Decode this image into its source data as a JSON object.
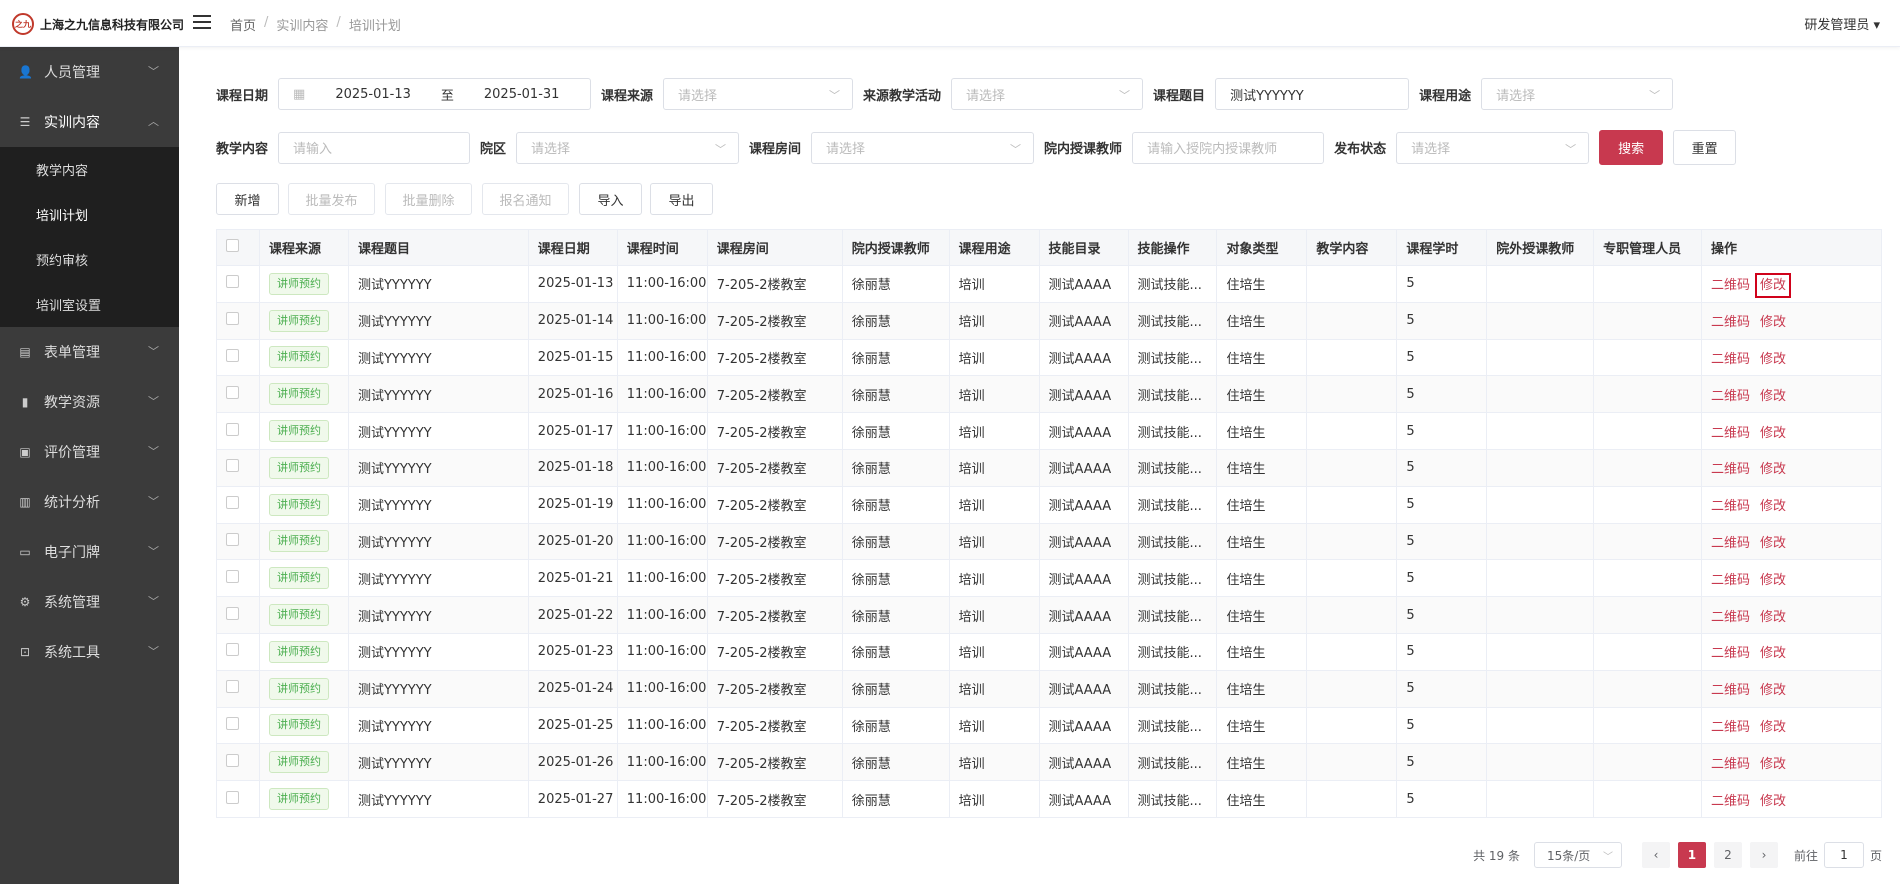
{
  "header": {
    "logo_mark": "之九",
    "logo_text": "上海之九信息科技有限公司",
    "breadcrumb": [
      "首页",
      "实训内容",
      "培训计划"
    ],
    "user": "研发管理员 ▾"
  },
  "sidebar": {
    "items": [
      {
        "label": "人员管理",
        "icon": "user-icon"
      },
      {
        "label": "实训内容",
        "icon": "book-icon",
        "expanded": true
      },
      {
        "label": "表单管理",
        "icon": "form-icon"
      },
      {
        "label": "教学资源",
        "icon": "resource-icon"
      },
      {
        "label": "评价管理",
        "icon": "evaluate-icon"
      },
      {
        "label": "统计分析",
        "icon": "chart-icon"
      },
      {
        "label": "电子门牌",
        "icon": "monitor-icon"
      },
      {
        "label": "系统管理",
        "icon": "gear-icon"
      },
      {
        "label": "系统工具",
        "icon": "toolbox-icon"
      }
    ],
    "sub_items": [
      "教学内容",
      "培训计划",
      "预约审核",
      "培训室设置"
    ],
    "active_sub": "培训计划"
  },
  "filters": {
    "course_date_label": "课程日期",
    "date_start": "2025-01-13",
    "date_sep": "至",
    "date_end": "2025-01-31",
    "course_source_label": "课程来源",
    "course_source_placeholder": "请选择",
    "source_activity_label": "来源教学活动",
    "source_activity_placeholder": "请选择",
    "course_title_label": "课程题目",
    "course_title_value": "测试YYYYYY",
    "course_use_label": "课程用途",
    "course_use_placeholder": "请选择",
    "teach_content_label": "教学内容",
    "teach_content_placeholder": "请输入",
    "campus_label": "院区",
    "campus_placeholder": "请选择",
    "room_label": "课程房间",
    "room_placeholder": "请选择",
    "inner_teacher_label": "院内授课教师",
    "inner_teacher_placeholder": "请输入授院内授课教师",
    "publish_label": "发布状态",
    "publish_placeholder": "请选择",
    "search": "搜索",
    "reset": "重置"
  },
  "toolbar": {
    "add": "新增",
    "batch_publish": "批量发布",
    "batch_delete": "批量删除",
    "signup_notice": "报名通知",
    "import": "导入",
    "export": "导出"
  },
  "table": {
    "columns": [
      "课程来源",
      "课程题目",
      "课程日期",
      "课程时间",
      "课程房间",
      "院内授课教师",
      "课程用途",
      "技能目录",
      "技能操作",
      "对象类型",
      "教学内容",
      "课程学时",
      "院外授课教师",
      "专职管理人员",
      "操作"
    ],
    "row_template": {
      "source": "讲师预约",
      "title": "测试YYYYYY",
      "time": "11:00-16:00",
      "room": "7-205-2楼教室",
      "teacher": "徐丽慧",
      "use": "培训",
      "skill_dir": "测试AAAA",
      "skill_op": "测试技能...",
      "target": "住培生",
      "content": "",
      "hours": "5",
      "outer_teacher": "",
      "manager": ""
    },
    "dates": [
      "2025-01-13",
      "2025-01-14",
      "2025-01-15",
      "2025-01-16",
      "2025-01-17",
      "2025-01-18",
      "2025-01-19",
      "2025-01-20",
      "2025-01-21",
      "2025-01-22",
      "2025-01-23",
      "2025-01-24",
      "2025-01-25",
      "2025-01-26",
      "2025-01-27"
    ],
    "op_qrcode": "二维码",
    "op_edit": "修改"
  },
  "pagination": {
    "total": "共 19 条",
    "page_size": "15条/页",
    "pages": [
      "1",
      "2"
    ],
    "current": "1",
    "goto_label": "前往",
    "goto_value": "1",
    "page_suffix": "页",
    "prev": "‹",
    "next": "›"
  },
  "colors": {
    "accent": "#c8394f",
    "sidebar_bg": "#3b3b3b",
    "submenu_bg": "#1f1f1f",
    "tag_green": "#4caf50"
  }
}
